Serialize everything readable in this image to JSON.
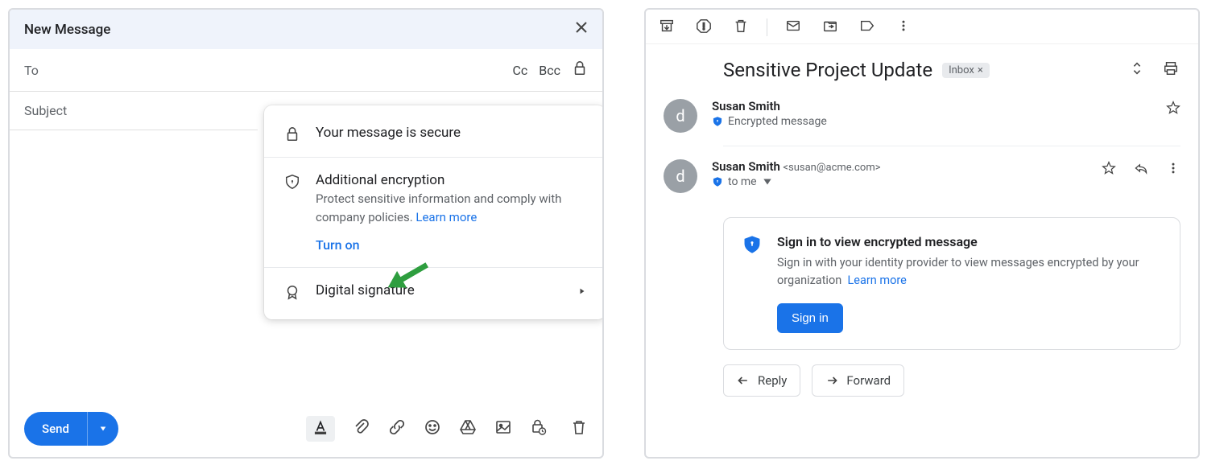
{
  "compose": {
    "title": "New Message",
    "to_label": "To",
    "cc_label": "Cc",
    "bcc_label": "Bcc",
    "subject_label": "Subject",
    "send_label": "Send"
  },
  "popup": {
    "secure_title": "Your message is secure",
    "encryption_title": "Additional encryption",
    "encryption_desc": "Protect sensitive information and comply with company policies. ",
    "learn_more": "Learn more",
    "turn_on": "Turn on",
    "signature_title": "Digital signature"
  },
  "reader": {
    "subject": "Sensitive Project Update",
    "inbox_chip": "Inbox",
    "msg1": {
      "sender": "Susan Smith",
      "avatar": "d",
      "encrypted_label": "Encrypted message"
    },
    "msg2": {
      "sender": "Susan Smith",
      "email": "<susan@acme.com>",
      "avatar": "d",
      "to_me": "to me"
    },
    "card": {
      "title": "Sign in to view encrypted message",
      "desc": "Sign in with your identity provider to view messages encrypted by your organization",
      "learn_more": "Learn  more",
      "signin": "Sign in"
    },
    "reply": "Reply",
    "forward": "Forward"
  }
}
